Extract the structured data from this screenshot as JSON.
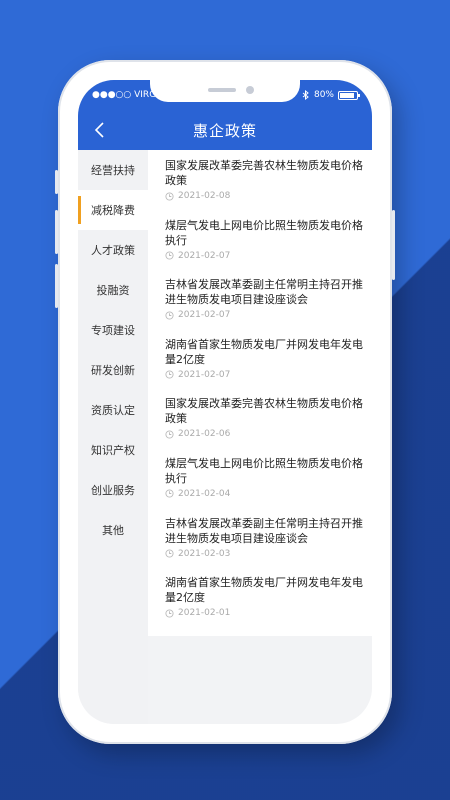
{
  "status_bar": {
    "carrier": "●●●○○ VIRGIN",
    "battery_text": "80%"
  },
  "header": {
    "title": "惠企政策"
  },
  "sidebar": {
    "items": [
      {
        "label": "经营扶持"
      },
      {
        "label": "减税降费"
      },
      {
        "label": "人才政策"
      },
      {
        "label": "投融资"
      },
      {
        "label": "专项建设"
      },
      {
        "label": "研发创新"
      },
      {
        "label": "资质认定"
      },
      {
        "label": "知识产权"
      },
      {
        "label": "创业服务"
      },
      {
        "label": "其他"
      }
    ],
    "active_index": 1
  },
  "articles": [
    {
      "title": "国家发展改革委完善农林生物质发电价格政策",
      "date": "2021-02-08"
    },
    {
      "title": "煤层气发电上网电价比照生物质发电价格执行",
      "date": "2021-02-07"
    },
    {
      "title": "吉林省发展改革委副主任常明主持召开推进生物质发电项目建设座谈会",
      "date": "2021-02-07"
    },
    {
      "title": "湖南省首家生物质发电厂并网发电年发电量2亿度",
      "date": "2021-02-07"
    },
    {
      "title": "国家发展改革委完善农林生物质发电价格政策",
      "date": "2021-02-06"
    },
    {
      "title": "煤层气发电上网电价比照生物质发电价格执行",
      "date": "2021-02-04"
    },
    {
      "title": "吉林省发展改革委副主任常明主持召开推进生物质发电项目建设座谈会",
      "date": "2021-02-03"
    },
    {
      "title": "湖南省首家生物质发电厂并网发电年发电量2亿度",
      "date": "2021-02-01"
    }
  ],
  "colors": {
    "brand_blue": "#2a63d4",
    "active_accent": "#f0a020"
  }
}
